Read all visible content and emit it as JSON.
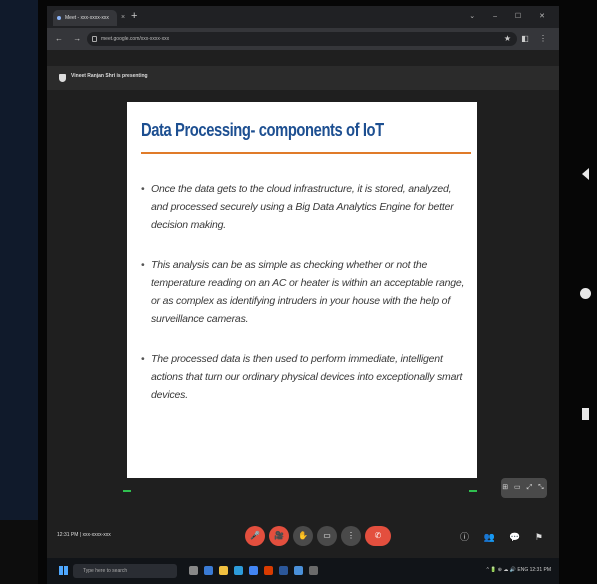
{
  "browser": {
    "tab_label": "Meet - xxx-xxxx-xxx",
    "tab_close": "×",
    "new_tab": "+",
    "window_controls": "⌄ – ☐ ✕",
    "nav": "← → ⟳",
    "url": "meet.google.com/xxx-xxxx-xxx",
    "extensions": "★ ◧ ⋮"
  },
  "meeting": {
    "presenter_banner": "Vineet Ranjan Shri is presenting",
    "time_label": "12:31 PM  |  xxx-xxxx-xxx",
    "controls": [
      "🎤",
      "🎥",
      "✋",
      "▭",
      "⋮",
      "✆"
    ],
    "right_icons": "ⓘ 👥 💬 ⚑"
  },
  "slide": {
    "title": "Data Processing- components of IoT",
    "bullets": [
      "Once the data gets to the cloud infrastructure, it is stored, analyzed, and processed securely using a Big Data Analytics Engine for better decision making.",
      "This analysis can be as simple as checking whether or not the temperature reading on an AC or heater is within an acceptable range, or as complex as identifying intruders in your house with the help of surveillance cameras.",
      "The processed data is then used to perform immediate, intelligent actions that turn our ordinary physical devices into exceptionally smart devices."
    ],
    "slide_controls": "⊞ ▭ ⤢ ⤡"
  },
  "taskbar": {
    "search_placeholder": "Type here to search",
    "tray": "^ 🔋 ⊕ ☁ 🔊 ENG 12:31 PM"
  },
  "colors": {
    "title_blue": "#1d4f91",
    "rule_orange": "#e07b29",
    "control_red": "#e34f3e"
  }
}
